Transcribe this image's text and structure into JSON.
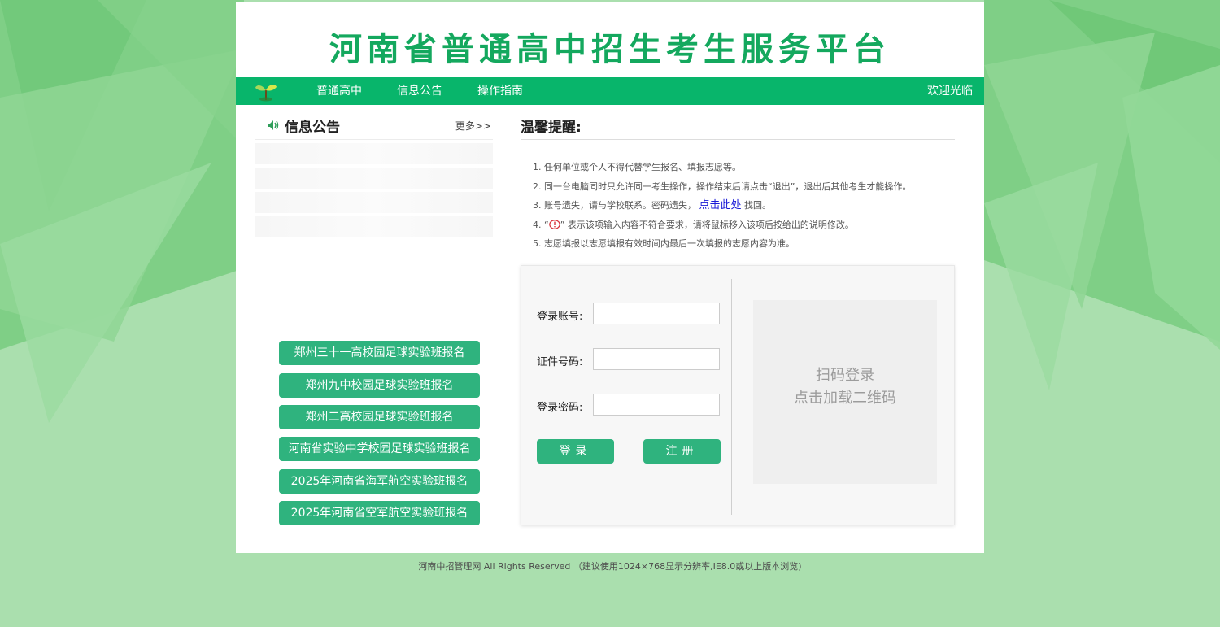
{
  "site": {
    "title": "河南省普通高中招生考生服务平台"
  },
  "nav": {
    "items": [
      "普通高中",
      "信息公告",
      "操作指南"
    ],
    "welcome": "欢迎光临"
  },
  "notice": {
    "title": "信息公告",
    "more": "更多>>"
  },
  "signup_buttons": [
    "郑州三十一高校园足球实验班报名",
    "郑州九中校园足球实验班报名",
    "郑州二高校园足球实验班报名",
    "河南省实验中学校园足球实验班报名",
    "2025年河南省海军航空实验班报名",
    "2025年河南省空军航空实验班报名"
  ],
  "tips": {
    "title": "温馨提醒:",
    "items": [
      "1. 任何单位或个人不得代替学生报名、填报志愿等。",
      "2. 同一台电脑同时只允许同一考生操作，操作结束后请点击“退出”，退出后其他考生才能操作。",
      "3. 账号遗失，请与学校联系。密码遗失，",
      "点击此处",
      "找回。",
      "4. “",
      "” 表示该项输入内容不符合要求，请将鼠标移入该项后按给出的说明修改。",
      "5. 志愿填报以志愿填报有效时间内最后一次填报的志愿内容为准。"
    ]
  },
  "login": {
    "account_label": "登录账号:",
    "account_value": "",
    "id_label": "证件号码:",
    "id_value": "",
    "password_label": "登录密码:",
    "password_value": "",
    "login_button": "登录",
    "register_button": "注册",
    "qr_line1": "扫码登录",
    "qr_line2": "点击加载二维码"
  },
  "footer": {
    "text": "河南中招管理网 All Rights Reserved （建议使用1024×768显示分辨率,IE8.0或以上版本浏览)"
  },
  "colors": {
    "brand_green": "#08b56b",
    "title_green": "#14a85e",
    "button_green": "#2fb37e",
    "background": "#aadfae",
    "link_blue": "#1a1ad6"
  },
  "icons": {
    "logo": "sprout-logo-icon",
    "notice": "speaker-icon",
    "warning": "warning-icon"
  }
}
